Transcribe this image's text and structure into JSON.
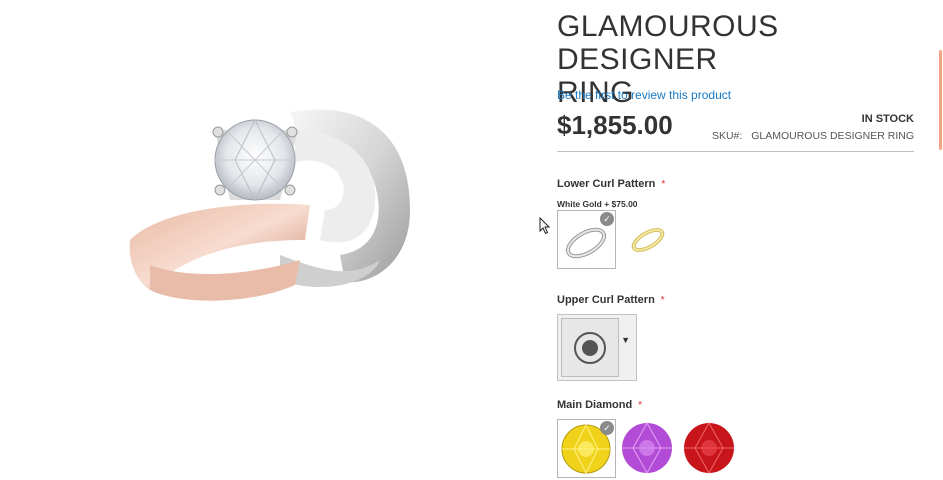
{
  "product": {
    "title_line1": "GLAMOUROUS DESIGNER",
    "title_line2": "RING",
    "review_link": "Be the first to review this product",
    "price": "$1,855.00",
    "stock": "IN STOCK",
    "sku_label": "SKU#:",
    "sku_value": "GLAMOUROUS DESIGNER RING"
  },
  "options": {
    "lower_curl": {
      "label": "Lower Curl Pattern",
      "required_mark": "*",
      "selected_caption": "White Gold + $75.00",
      "swatches": [
        {
          "name": "white-gold",
          "selected": true
        },
        {
          "name": "yellow-gold",
          "selected": false
        }
      ]
    },
    "upper_curl": {
      "label": "Upper Curl Pattern",
      "required_mark": "*",
      "arrow": "▼"
    },
    "main_diamond": {
      "label": "Main Diamond",
      "required_mark": "*",
      "swatches": [
        {
          "name": "yellow-gem",
          "color": "#f1d21a",
          "selected": true
        },
        {
          "name": "purple-gem",
          "color": "#b24bd6",
          "selected": false
        },
        {
          "name": "red-gem",
          "color": "#c8141b",
          "selected": false
        }
      ]
    }
  },
  "check_glyph": "✓",
  "colors": {
    "link": "#1979c3",
    "required": "#e02b27",
    "scrollbar": "#f1a581"
  }
}
